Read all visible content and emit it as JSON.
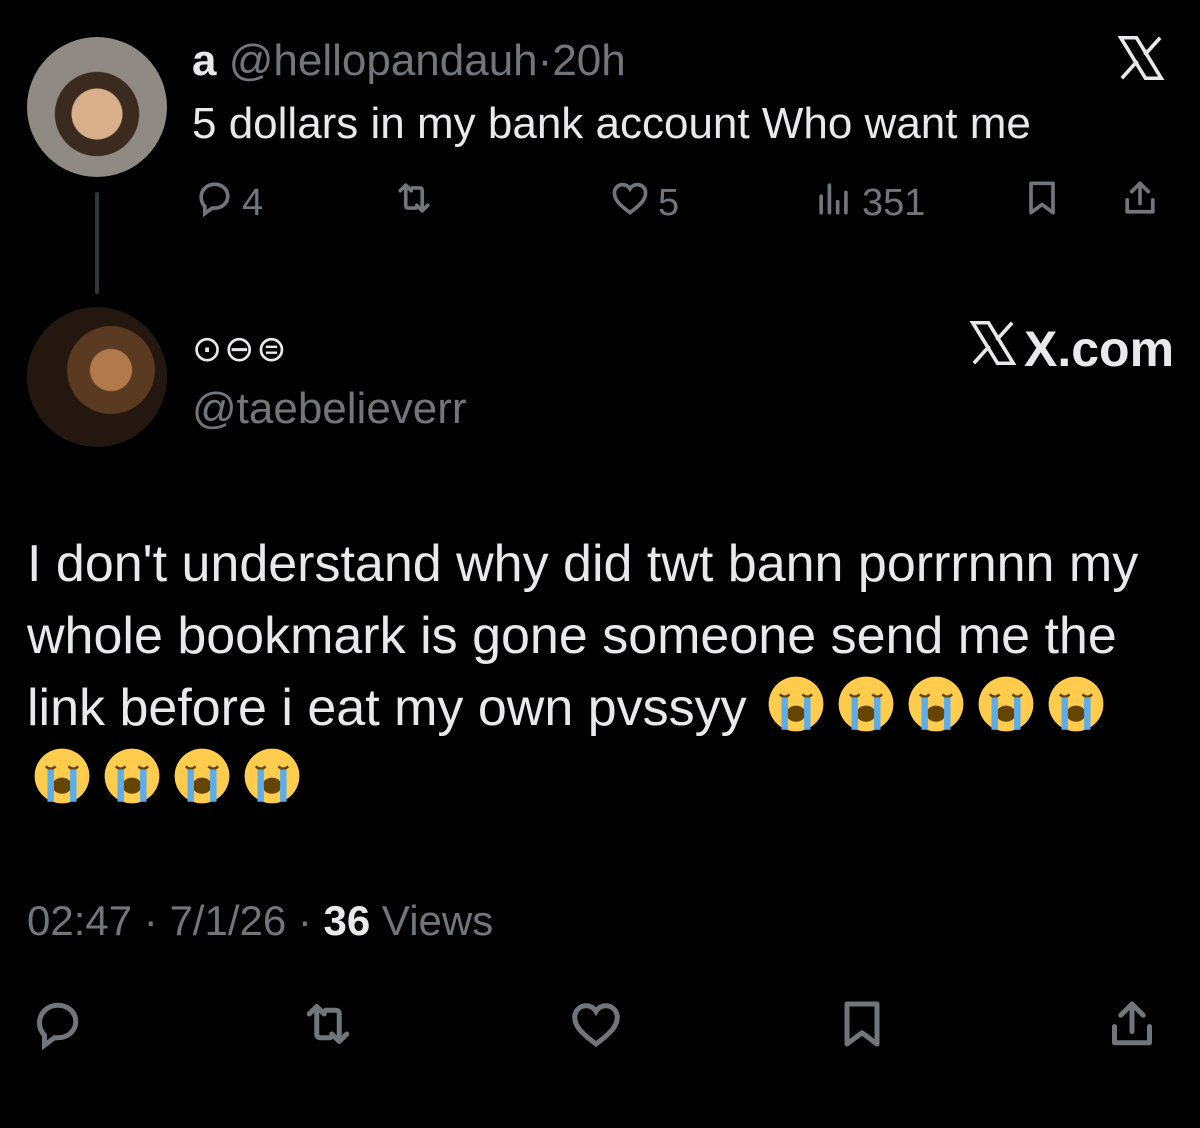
{
  "tweet1": {
    "name": "a",
    "handle": "@hellopandauh",
    "separator": "·",
    "time": "20h",
    "text": "5 dollars in my bank account Who want me",
    "stats": {
      "replies": "4",
      "retweets": "",
      "likes": "5",
      "views": "351"
    },
    "logo_icon": "x-logo-icon"
  },
  "tweet2": {
    "name": "⊙⊖⊜",
    "handle": "@taebelieverr",
    "watermark": "X.com",
    "text": "I don't understand why did twt bann porrrnnn my whole bookmark is gone someone send me the link before i eat my own pvssyy",
    "emoji_icon": "loudly-crying-face-icon",
    "emoji_count": 9,
    "meta": {
      "time": "02:47",
      "separator1": " · ",
      "date": "7/1/26",
      "separator2": " · ",
      "views_count": "36",
      "views_label": " Views"
    }
  },
  "colors": {
    "background": "#000000",
    "text_primary": "#e7e9ea",
    "text_secondary": "#71767b",
    "emoji_face": "#ffcc4d",
    "emoji_tears": "#5dadec"
  }
}
